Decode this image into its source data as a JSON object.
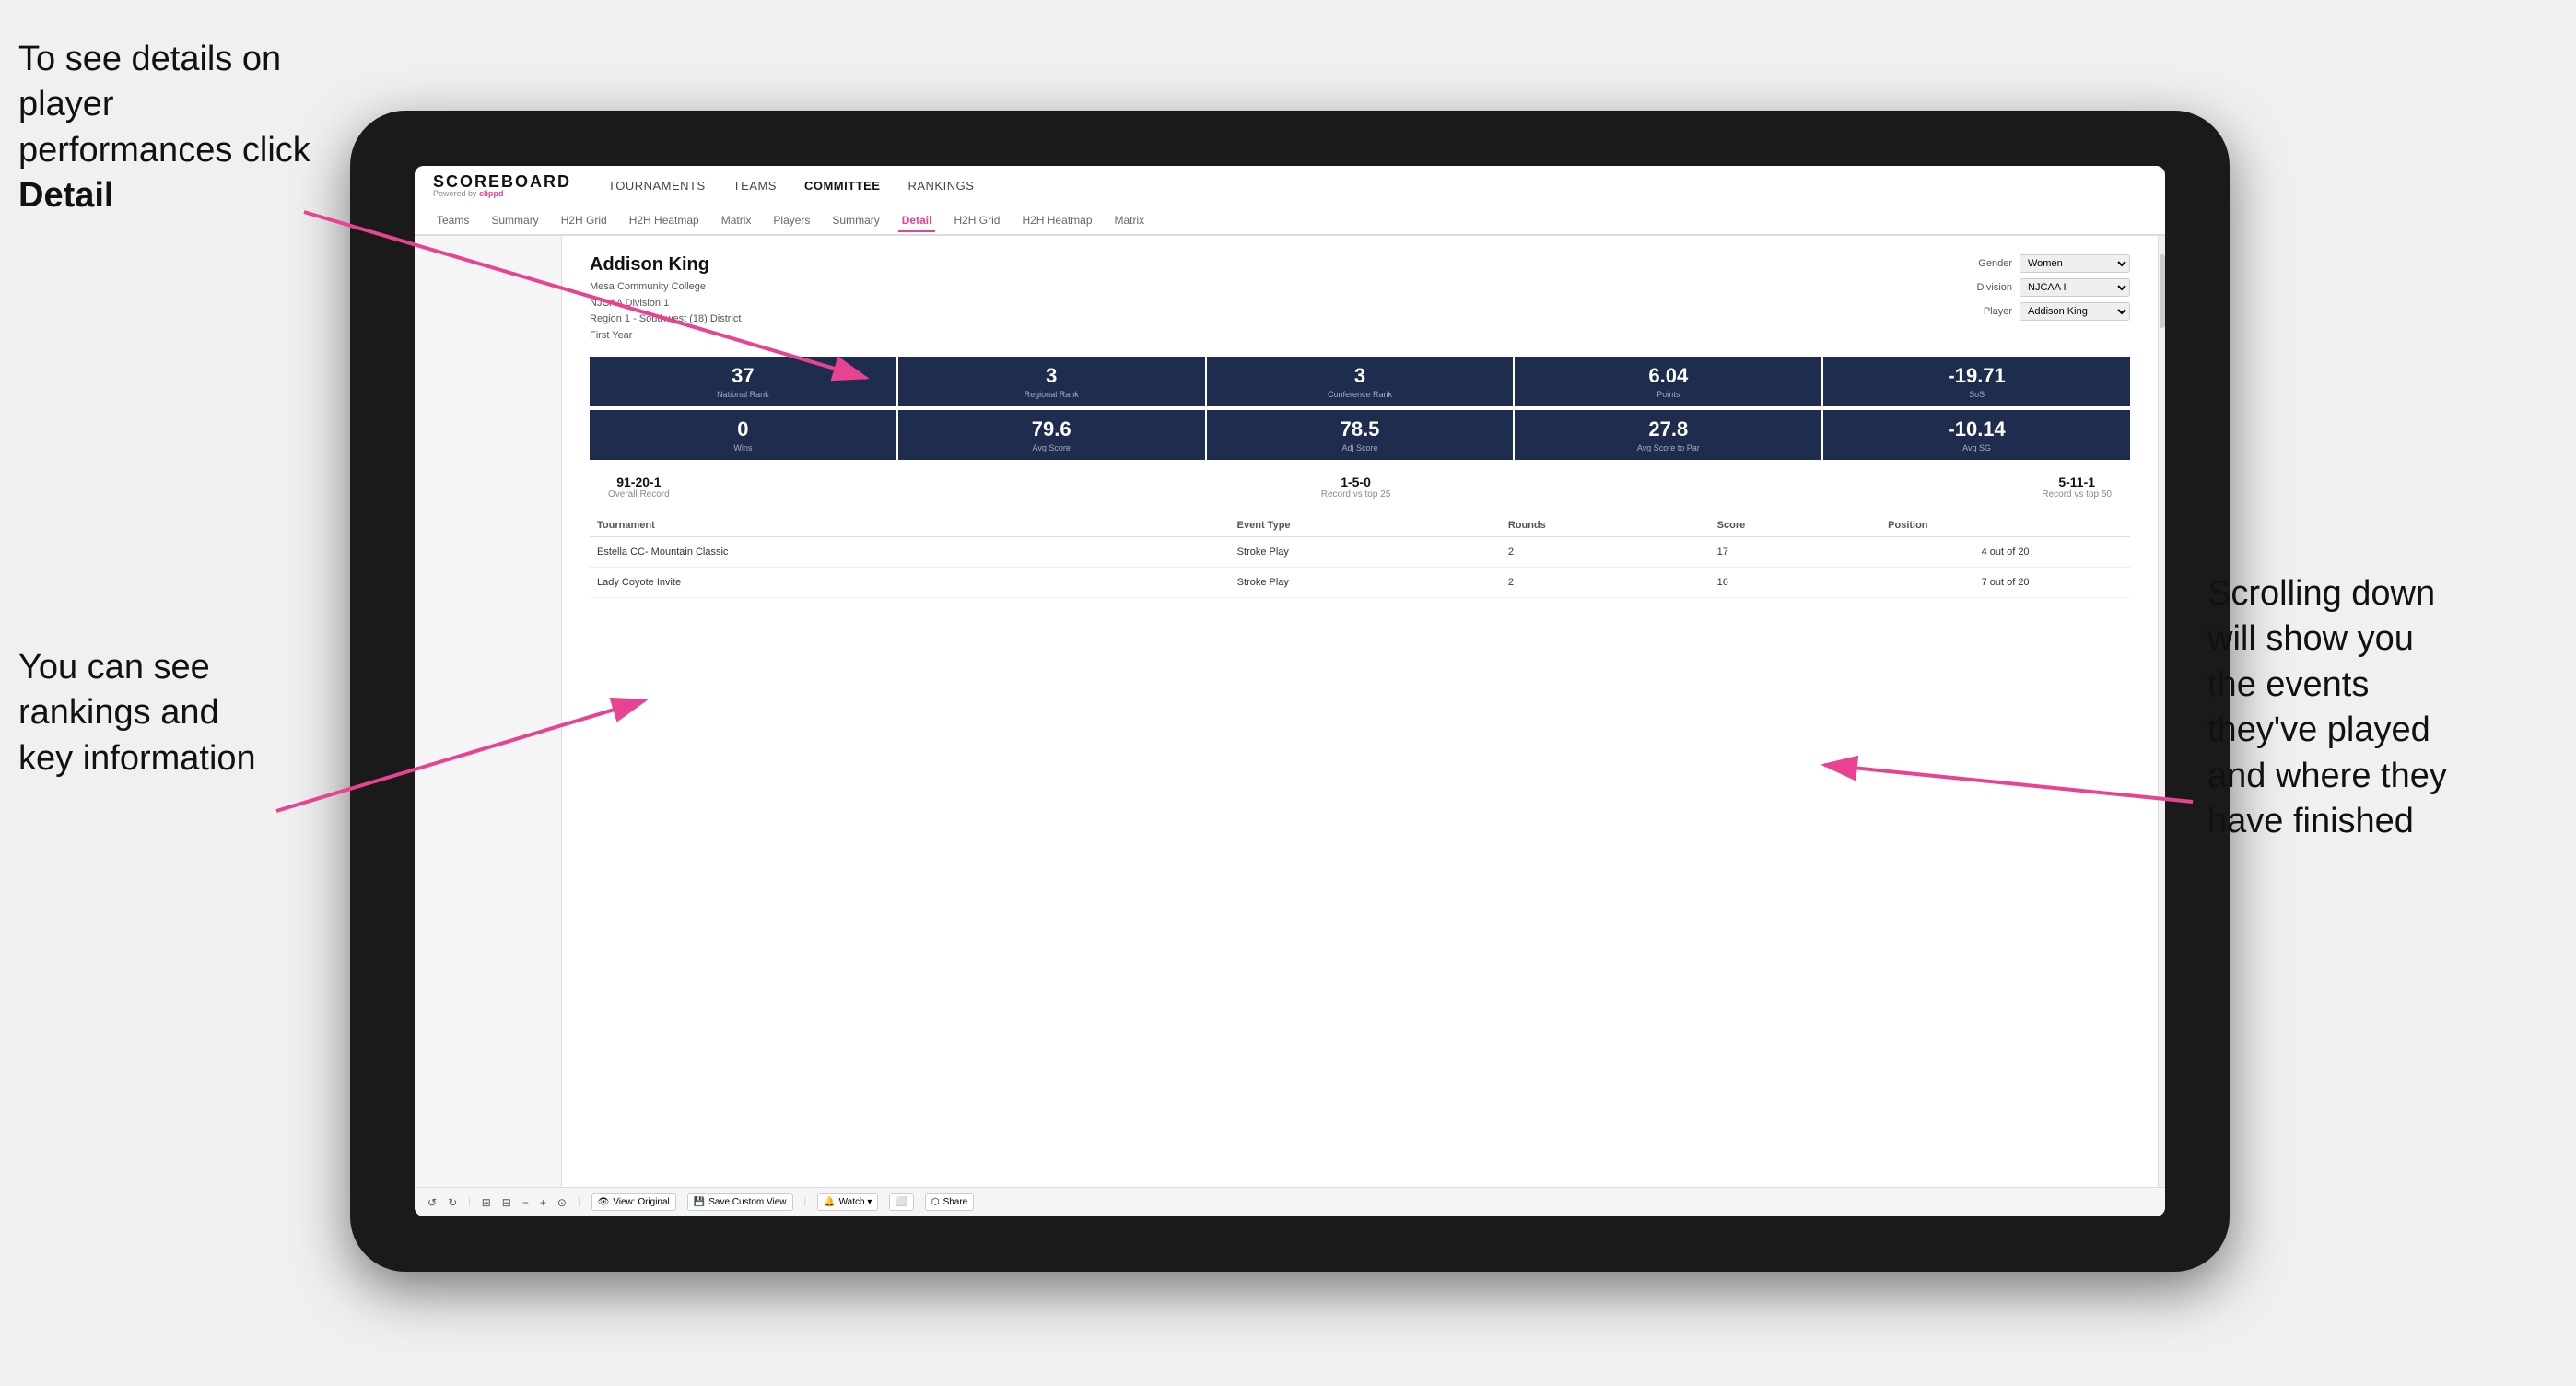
{
  "annotations": {
    "top_left": "To see details on player performances click ",
    "top_left_bold": "Detail",
    "bottom_left_line1": "You can see",
    "bottom_left_line2": "rankings and",
    "bottom_left_line3": "key information",
    "right_line1": "Scrolling down",
    "right_line2": "will show you",
    "right_line3": "the events",
    "right_line4": "they've played",
    "right_line5": "and where they",
    "right_line6": "have finished"
  },
  "app": {
    "logo": {
      "brand": "SCOREBOARD",
      "powered_by": "Powered by ",
      "clippd": "clippd"
    },
    "top_nav": [
      {
        "label": "TOURNAMENTS",
        "active": false
      },
      {
        "label": "TEAMS",
        "active": false
      },
      {
        "label": "COMMITTEE",
        "active": true
      },
      {
        "label": "RANKINGS",
        "active": false
      }
    ],
    "sub_nav": [
      {
        "label": "Teams",
        "active": false
      },
      {
        "label": "Summary",
        "active": false
      },
      {
        "label": "H2H Grid",
        "active": false
      },
      {
        "label": "H2H Heatmap",
        "active": false
      },
      {
        "label": "Matrix",
        "active": false
      },
      {
        "label": "Players",
        "active": false
      },
      {
        "label": "Summary",
        "active": false
      },
      {
        "label": "Detail",
        "active": true
      },
      {
        "label": "H2H Grid",
        "active": false
      },
      {
        "label": "H2H Heatmap",
        "active": false
      },
      {
        "label": "Matrix",
        "active": false
      }
    ],
    "player": {
      "name": "Addison King",
      "school": "Mesa Community College",
      "division": "NJCAA Division 1",
      "region": "Region 1 - Southwest (18) District",
      "year": "First Year",
      "filters": {
        "gender_label": "Gender",
        "gender_value": "Women",
        "division_label": "Division",
        "division_value": "NJCAA I",
        "player_label": "Player",
        "player_value": "Addison King"
      }
    },
    "stats_row1": [
      {
        "value": "37",
        "label": "National Rank"
      },
      {
        "value": "3",
        "label": "Regional Rank"
      },
      {
        "value": "3",
        "label": "Conference Rank"
      },
      {
        "value": "6.04",
        "label": "Points"
      },
      {
        "value": "-19.71",
        "label": "SoS"
      }
    ],
    "stats_row2": [
      {
        "value": "0",
        "label": "Wins"
      },
      {
        "value": "79.6",
        "label": "Avg Score"
      },
      {
        "value": "78.5",
        "label": "Adj Score"
      },
      {
        "value": "27.8",
        "label": "Avg Score to Par"
      },
      {
        "value": "-10.14",
        "label": "Avg SG"
      }
    ],
    "records": [
      {
        "value": "91-20-1",
        "label": "Overall Record"
      },
      {
        "value": "1-5-0",
        "label": "Record vs top 25"
      },
      {
        "value": "5-11-1",
        "label": "Record vs top 50"
      }
    ],
    "table_headers": [
      "Tournament",
      "",
      "Event Type",
      "Rounds",
      "Score",
      "Position"
    ],
    "tournaments": [
      {
        "name": "Estella CC- Mountain Classic",
        "event_type": "Stroke Play",
        "rounds": "2",
        "score": "17",
        "position": "4 out of 20"
      },
      {
        "name": "Lady Coyote Invite",
        "event_type": "Stroke Play",
        "rounds": "2",
        "score": "16",
        "position": "7 out of 20"
      }
    ],
    "toolbar": {
      "undo": "↺",
      "redo": "↻",
      "icons": [
        "⊞",
        "⊟",
        "−",
        "+",
        "⊙"
      ],
      "view_label": "View: Original",
      "save_label": "Save Custom View",
      "watch_label": "Watch ▾",
      "screen_label": "",
      "share_label": "Share"
    }
  }
}
